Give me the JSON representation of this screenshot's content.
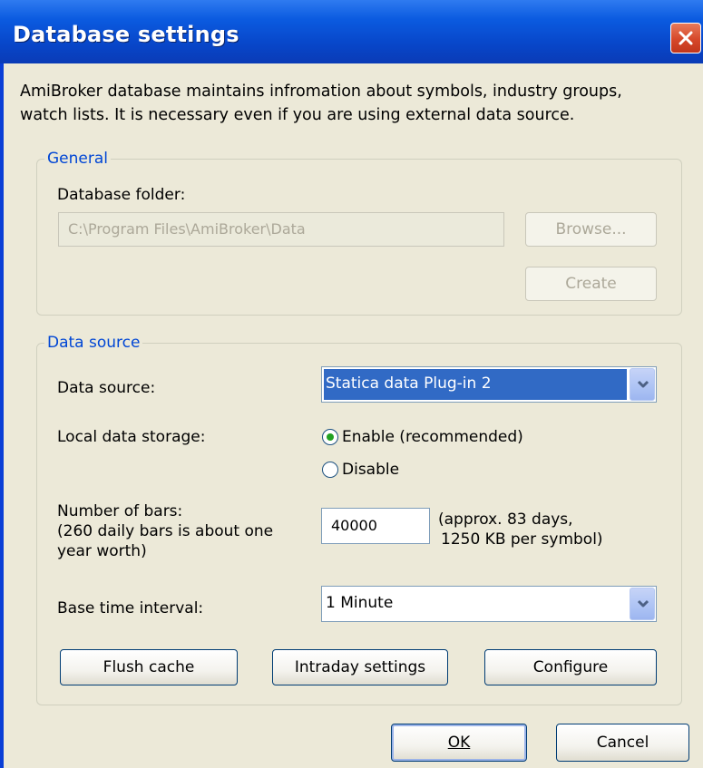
{
  "window": {
    "title": "Database settings",
    "intro_line1": "AmiBroker database maintains infromation about symbols, industry groups,",
    "intro_line2": "watch lists. It is necessary even if you are using external data source."
  },
  "general": {
    "legend": "General",
    "folder_label": "Database folder:",
    "folder_value": "C:\\Program Files\\AmiBroker\\Data",
    "browse_label": "Browse...",
    "create_label": "Create"
  },
  "datasource": {
    "legend": "Data source",
    "source_label": "Data source:",
    "source_value": "Statica data Plug-in 2",
    "storage_label": "Local data storage:",
    "enable_label": "Enable (recommended)",
    "disable_label": "Disable",
    "storage_selected": "enable",
    "bars_label": "Number of bars:\n(260 daily bars is about one year worth)",
    "bars_value": "40000",
    "bars_hint": "(approx. 83 days,\n1250 KB per symbol)",
    "interval_label": "Base time interval:",
    "interval_value": "1 Minute",
    "flush_label": "Flush cache",
    "intraday_label": "Intraday settings",
    "configure_label": "Configure"
  },
  "footer": {
    "ok_label": "OK",
    "cancel_label": "Cancel"
  },
  "colors": {
    "title_bar": "#0b5be0",
    "dialog_bg": "#ece9d8",
    "group_legend": "#0046d5",
    "selection": "#316ac5",
    "radio_dot": "#21a121",
    "close_button": "#d6482a"
  },
  "icons": {
    "close": "close-x-icon",
    "dropdown": "chevron-down-icon"
  }
}
